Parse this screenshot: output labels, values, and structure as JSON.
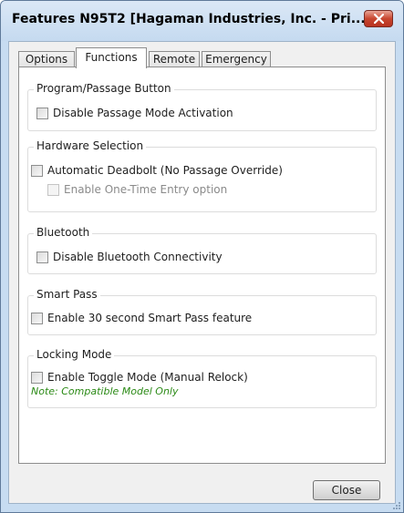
{
  "window": {
    "title": "Features N95T2 [Hagaman Industries, Inc. - Pri..."
  },
  "tabs": [
    {
      "label": "Options"
    },
    {
      "label": "Functions",
      "active": true
    },
    {
      "label": "Remote"
    },
    {
      "label": "Emergency"
    }
  ],
  "groups": {
    "program": {
      "label": "Program/Passage Button",
      "disable_passage": {
        "label": "Disable Passage Mode Activation",
        "checked": false
      }
    },
    "hardware": {
      "label": "Hardware Selection",
      "auto_deadbolt": {
        "label": "Automatic Deadbolt (No Passage Override)",
        "checked": false
      },
      "one_time_entry": {
        "label": "Enable One-Time Entry option",
        "checked": false,
        "enabled": false
      }
    },
    "bluetooth": {
      "label": "Bluetooth",
      "disable_bt": {
        "label": "Disable Bluetooth Connectivity",
        "checked": false
      }
    },
    "smart_pass": {
      "label": "Smart Pass",
      "enable_30s": {
        "label": "Enable 30 second Smart Pass feature",
        "checked": false
      }
    },
    "locking": {
      "label": "Locking Mode",
      "toggle_mode": {
        "label": "Enable Toggle Mode (Manual Relock)",
        "checked": false
      },
      "note": "Note: Compatible Model Only"
    }
  },
  "buttons": {
    "close": "Close"
  },
  "colors": {
    "window_frame": "#c7dcf1",
    "close_x": "#c8462f",
    "note_text": "#2b8a16"
  },
  "icons": {
    "title_close": "close-icon",
    "grip": "resize-grip-icon"
  }
}
